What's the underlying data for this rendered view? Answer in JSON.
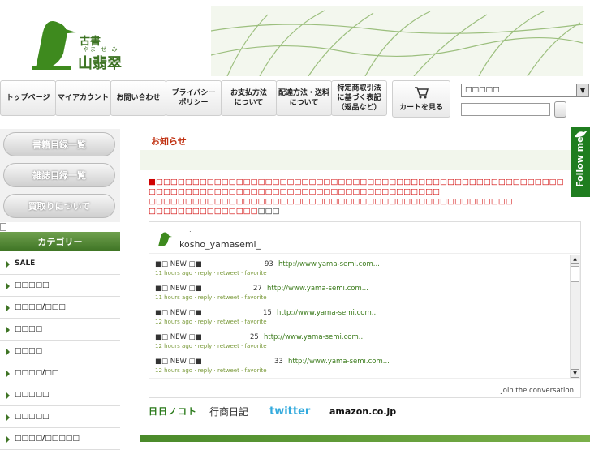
{
  "logo": {
    "kanji_top": "古書",
    "reading": "やま せ み",
    "name": "山翡翠"
  },
  "nav": [
    {
      "label": "トップページ"
    },
    {
      "label": "マイアカウント"
    },
    {
      "label": "お問い合わせ"
    },
    {
      "label": "プライバシー\nポリシー"
    },
    {
      "label": "お支払方法\nについて"
    },
    {
      "label": "配達方法・送料\nについて"
    },
    {
      "label": "特定商取引法\nに基づく表記\n（返品など）"
    }
  ],
  "cart_label": "カートを見る",
  "select_value": "□□□□□",
  "sidebar": {
    "pills": [
      "書籍目録一覧",
      "雑誌目録一覧",
      "買取りについて"
    ],
    "category_heading": "カテゴリー",
    "categories": [
      "SALE",
      "□□□□□",
      "□□□□/□□□",
      "□□□□",
      "□□□□",
      "□□□□/□□",
      "□□□□□",
      "□□□□□",
      "□□□□/□□□□□"
    ]
  },
  "main": {
    "notice_title": "お知らせ",
    "notice_lines": [
      "■□□□□□□□□□□□□□□□□□□□□□□□□□□□□□□□□□□□□□□□□□□□□□□□□□□□□□□□□",
      "□□□□□□□□□□□□□□□□□□□□□□□□□□□□□□□□□□□□□□□□",
      "□□□□□□□□□□□□□□□□□□□□□□□□□□□□□□□□□□□□□□□□□□□□□□□□□□",
      "□□□□□□□□□□□□□□□"
    ],
    "notice_tail": "□□□"
  },
  "twitter": {
    "colon": ":",
    "username": "kosho_yamasemi_",
    "join": "Join the conversation",
    "tweets": [
      {
        "text": "■□ NEW □■",
        "num": "93",
        "link": "http://www.yama-semi.com...",
        "meta": "11 hours ago · reply · retweet · favorite"
      },
      {
        "text": "■□ NEW □■",
        "num": "27",
        "link": "http://www.yama-semi.com...",
        "meta": "11 hours ago · reply · retweet · favorite"
      },
      {
        "text": "■□ NEW □■",
        "num": "15",
        "link": "http://www.yama-semi.com...",
        "meta": "12 hours ago · reply · retweet · favorite"
      },
      {
        "text": "■□ NEW □■",
        "num": "25",
        "link": "http://www.yama-semi.com...",
        "meta": "12 hours ago · reply · retweet · favorite"
      },
      {
        "text": "■□ NEW □■",
        "num": "33",
        "link": "http://www.yama-semi.com...",
        "meta": "12 hours ago · reply · retweet · favorite"
      }
    ]
  },
  "badges": [
    "日日ノコト",
    "行商日記",
    "twitter",
    "amazon.co.jp"
  ],
  "follow_label": "Follow me",
  "colors": {
    "accent_green": "#3e7424",
    "notice_red": "#d00000",
    "follow_green": "#1f7d1f"
  }
}
